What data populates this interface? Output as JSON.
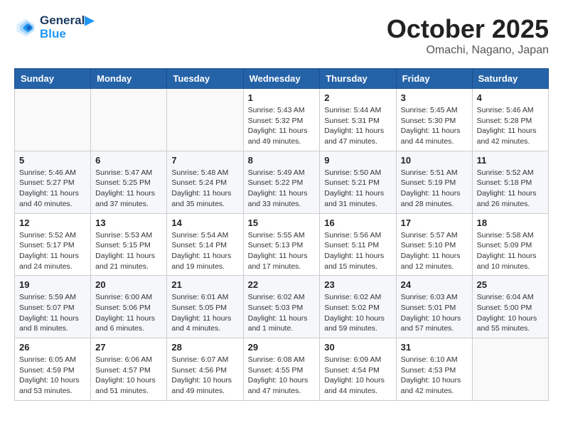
{
  "header": {
    "logo_line1": "General",
    "logo_line2": "Blue",
    "month_title": "October 2025",
    "location": "Omachi, Nagano, Japan"
  },
  "weekdays": [
    "Sunday",
    "Monday",
    "Tuesday",
    "Wednesday",
    "Thursday",
    "Friday",
    "Saturday"
  ],
  "weeks": [
    [
      {
        "day": "",
        "sunrise": "",
        "sunset": "",
        "daylight": ""
      },
      {
        "day": "",
        "sunrise": "",
        "sunset": "",
        "daylight": ""
      },
      {
        "day": "",
        "sunrise": "",
        "sunset": "",
        "daylight": ""
      },
      {
        "day": "1",
        "sunrise": "Sunrise: 5:43 AM",
        "sunset": "Sunset: 5:32 PM",
        "daylight": "Daylight: 11 hours and 49 minutes."
      },
      {
        "day": "2",
        "sunrise": "Sunrise: 5:44 AM",
        "sunset": "Sunset: 5:31 PM",
        "daylight": "Daylight: 11 hours and 47 minutes."
      },
      {
        "day": "3",
        "sunrise": "Sunrise: 5:45 AM",
        "sunset": "Sunset: 5:30 PM",
        "daylight": "Daylight: 11 hours and 44 minutes."
      },
      {
        "day": "4",
        "sunrise": "Sunrise: 5:46 AM",
        "sunset": "Sunset: 5:28 PM",
        "daylight": "Daylight: 11 hours and 42 minutes."
      }
    ],
    [
      {
        "day": "5",
        "sunrise": "Sunrise: 5:46 AM",
        "sunset": "Sunset: 5:27 PM",
        "daylight": "Daylight: 11 hours and 40 minutes."
      },
      {
        "day": "6",
        "sunrise": "Sunrise: 5:47 AM",
        "sunset": "Sunset: 5:25 PM",
        "daylight": "Daylight: 11 hours and 37 minutes."
      },
      {
        "day": "7",
        "sunrise": "Sunrise: 5:48 AM",
        "sunset": "Sunset: 5:24 PM",
        "daylight": "Daylight: 11 hours and 35 minutes."
      },
      {
        "day": "8",
        "sunrise": "Sunrise: 5:49 AM",
        "sunset": "Sunset: 5:22 PM",
        "daylight": "Daylight: 11 hours and 33 minutes."
      },
      {
        "day": "9",
        "sunrise": "Sunrise: 5:50 AM",
        "sunset": "Sunset: 5:21 PM",
        "daylight": "Daylight: 11 hours and 31 minutes."
      },
      {
        "day": "10",
        "sunrise": "Sunrise: 5:51 AM",
        "sunset": "Sunset: 5:19 PM",
        "daylight": "Daylight: 11 hours and 28 minutes."
      },
      {
        "day": "11",
        "sunrise": "Sunrise: 5:52 AM",
        "sunset": "Sunset: 5:18 PM",
        "daylight": "Daylight: 11 hours and 26 minutes."
      }
    ],
    [
      {
        "day": "12",
        "sunrise": "Sunrise: 5:52 AM",
        "sunset": "Sunset: 5:17 PM",
        "daylight": "Daylight: 11 hours and 24 minutes."
      },
      {
        "day": "13",
        "sunrise": "Sunrise: 5:53 AM",
        "sunset": "Sunset: 5:15 PM",
        "daylight": "Daylight: 11 hours and 21 minutes."
      },
      {
        "day": "14",
        "sunrise": "Sunrise: 5:54 AM",
        "sunset": "Sunset: 5:14 PM",
        "daylight": "Daylight: 11 hours and 19 minutes."
      },
      {
        "day": "15",
        "sunrise": "Sunrise: 5:55 AM",
        "sunset": "Sunset: 5:13 PM",
        "daylight": "Daylight: 11 hours and 17 minutes."
      },
      {
        "day": "16",
        "sunrise": "Sunrise: 5:56 AM",
        "sunset": "Sunset: 5:11 PM",
        "daylight": "Daylight: 11 hours and 15 minutes."
      },
      {
        "day": "17",
        "sunrise": "Sunrise: 5:57 AM",
        "sunset": "Sunset: 5:10 PM",
        "daylight": "Daylight: 11 hours and 12 minutes."
      },
      {
        "day": "18",
        "sunrise": "Sunrise: 5:58 AM",
        "sunset": "Sunset: 5:09 PM",
        "daylight": "Daylight: 11 hours and 10 minutes."
      }
    ],
    [
      {
        "day": "19",
        "sunrise": "Sunrise: 5:59 AM",
        "sunset": "Sunset: 5:07 PM",
        "daylight": "Daylight: 11 hours and 8 minutes."
      },
      {
        "day": "20",
        "sunrise": "Sunrise: 6:00 AM",
        "sunset": "Sunset: 5:06 PM",
        "daylight": "Daylight: 11 hours and 6 minutes."
      },
      {
        "day": "21",
        "sunrise": "Sunrise: 6:01 AM",
        "sunset": "Sunset: 5:05 PM",
        "daylight": "Daylight: 11 hours and 4 minutes."
      },
      {
        "day": "22",
        "sunrise": "Sunrise: 6:02 AM",
        "sunset": "Sunset: 5:03 PM",
        "daylight": "Daylight: 11 hours and 1 minute."
      },
      {
        "day": "23",
        "sunrise": "Sunrise: 6:02 AM",
        "sunset": "Sunset: 5:02 PM",
        "daylight": "Daylight: 10 hours and 59 minutes."
      },
      {
        "day": "24",
        "sunrise": "Sunrise: 6:03 AM",
        "sunset": "Sunset: 5:01 PM",
        "daylight": "Daylight: 10 hours and 57 minutes."
      },
      {
        "day": "25",
        "sunrise": "Sunrise: 6:04 AM",
        "sunset": "Sunset: 5:00 PM",
        "daylight": "Daylight: 10 hours and 55 minutes."
      }
    ],
    [
      {
        "day": "26",
        "sunrise": "Sunrise: 6:05 AM",
        "sunset": "Sunset: 4:59 PM",
        "daylight": "Daylight: 10 hours and 53 minutes."
      },
      {
        "day": "27",
        "sunrise": "Sunrise: 6:06 AM",
        "sunset": "Sunset: 4:57 PM",
        "daylight": "Daylight: 10 hours and 51 minutes."
      },
      {
        "day": "28",
        "sunrise": "Sunrise: 6:07 AM",
        "sunset": "Sunset: 4:56 PM",
        "daylight": "Daylight: 10 hours and 49 minutes."
      },
      {
        "day": "29",
        "sunrise": "Sunrise: 6:08 AM",
        "sunset": "Sunset: 4:55 PM",
        "daylight": "Daylight: 10 hours and 47 minutes."
      },
      {
        "day": "30",
        "sunrise": "Sunrise: 6:09 AM",
        "sunset": "Sunset: 4:54 PM",
        "daylight": "Daylight: 10 hours and 44 minutes."
      },
      {
        "day": "31",
        "sunrise": "Sunrise: 6:10 AM",
        "sunset": "Sunset: 4:53 PM",
        "daylight": "Daylight: 10 hours and 42 minutes."
      },
      {
        "day": "",
        "sunrise": "",
        "sunset": "",
        "daylight": ""
      }
    ]
  ]
}
